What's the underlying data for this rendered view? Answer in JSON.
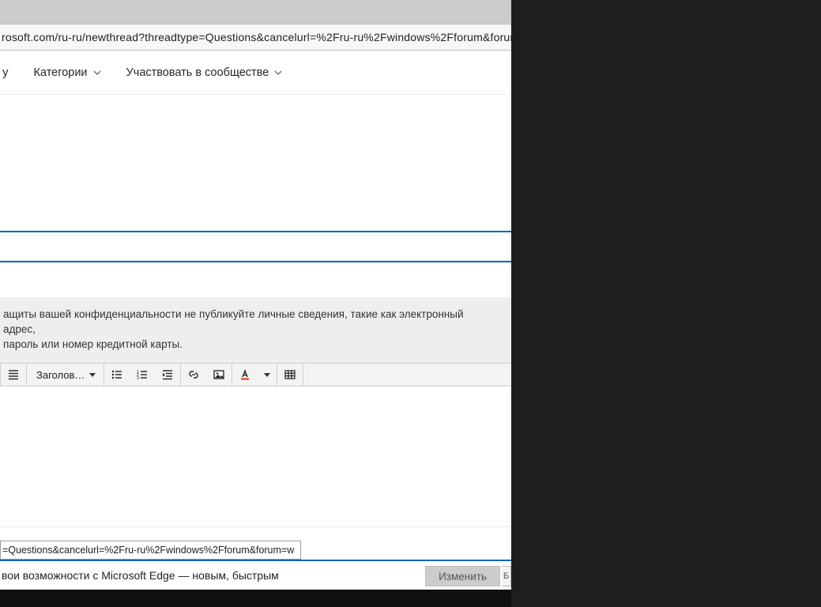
{
  "browser": {
    "url_fragment": "rosoft.com/ru-ru/newthread?threadtype=Questions&cancelurl=%2Fru-ru%2Fwindows%2Fforum&forum=windo"
  },
  "nav": {
    "trailing_char": "y",
    "categories": "Категории",
    "participate": "Участвовать в сообществе"
  },
  "notice": {
    "line1": "ащиты вашей конфиденциальности не публикуйте личные сведения, такие как электронный адрес,",
    "line2": "пароль или номер кредитной карты."
  },
  "toolbar": {
    "heading_label": "Заголов…"
  },
  "status": {
    "text": "=Questions&cancelurl=%2Fru-ru%2Fwindows%2Fforum&forum=w"
  },
  "promo": {
    "text": "вои возможности с Microsoft Edge — новым, быстрым",
    "button_partial": "Изменить ",
    "more_glyph": "Б"
  }
}
